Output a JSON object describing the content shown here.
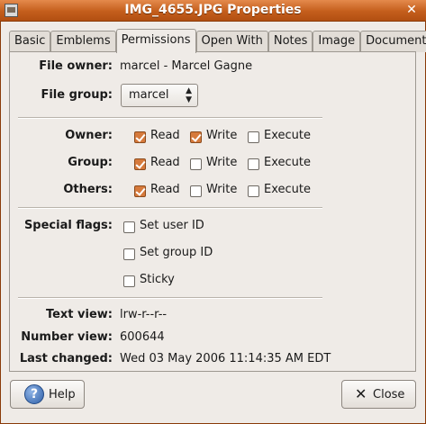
{
  "window": {
    "title": "IMG_4655.JPG Properties"
  },
  "tabs": [
    "Basic",
    "Emblems",
    "Permissions",
    "Open With",
    "Notes",
    "Image",
    "Document"
  ],
  "owner": {
    "label": "File owner:",
    "value": "marcel - Marcel Gagne"
  },
  "group": {
    "label": "File group:",
    "selected": "marcel"
  },
  "perms": {
    "read_label": "Read",
    "write_label": "Write",
    "execute_label": "Execute",
    "rows": [
      {
        "label": "Owner:",
        "read": true,
        "write": true,
        "execute": false
      },
      {
        "label": "Group:",
        "read": true,
        "write": false,
        "execute": false
      },
      {
        "label": "Others:",
        "read": true,
        "write": false,
        "execute": false
      }
    ]
  },
  "special": {
    "label": "Special flags:",
    "set_uid": "Set user ID",
    "set_gid": "Set group ID",
    "sticky": "Sticky",
    "values": {
      "set_uid": false,
      "set_gid": false,
      "sticky": false
    }
  },
  "info": {
    "text_view_label": "Text view:",
    "text_view": "lrw-r--r--",
    "number_view_label": "Number view:",
    "number_view": "600644",
    "last_changed_label": "Last changed:",
    "last_changed": "Wed 03 May 2006 11:14:35 AM EDT"
  },
  "buttons": {
    "help": "Help",
    "close": "Close"
  },
  "colors": {
    "titlebar": "#c45e1c",
    "checkbox_checked": "#d67a3c",
    "background": "#efebe7"
  }
}
